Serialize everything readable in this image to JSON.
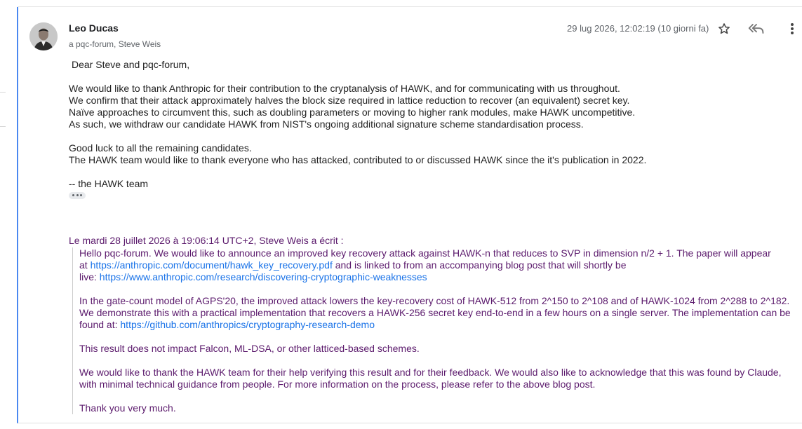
{
  "message": {
    "sender": "Leo Ducas",
    "recipients": "a pqc-forum, Steve Weis",
    "date": "29 lug 2026, 12:02:19 (10 giorni fa)",
    "icons": {
      "star": "star-icon",
      "reply_all": "reply-all-icon",
      "more": "more-vert-icon"
    },
    "greeting": "Dear Steve and pqc-forum,",
    "paragraph1": [
      "We would like to thank Anthropic for their contribution to the cryptanalysis of HAWK, and for communicating with us throughout.",
      "We confirm that their attack approximately halves the block size required in lattice reduction to recover (an equivalent) secret key.",
      "Naïve approaches to circumvent this, such as doubling parameters or moving to higher rank modules, make HAWK uncompetitive.",
      "As such, we withdraw our candidate HAWK from NIST's ongoing additional signature scheme standardisation process."
    ],
    "paragraph2": [
      "Good luck to all the remaining candidates.",
      "The HAWK team would like to thank everyone who has attacked, contributed to or discussed HAWK since the it's publication in 2022."
    ],
    "signoff": "-- the HAWK team"
  },
  "quoted": {
    "header": "Le mardi 28 juillet 2026 à 19:06:14 UTC+2, Steve Weis a écrit :",
    "p1_line1": "Hello pqc-forum. We would like to announce an improved key recovery attack against HAWK-n that reduces to SVP in dimension n/2 + 1. The paper will appear",
    "p1_line2_pre": "at ",
    "p1_link1": "https://anthropic.com/document/hawk_key_recovery.pdf",
    "p1_line2_post": " and is linked to from an accompanying blog post that will shortly be",
    "p1_line3_pre": "live: ",
    "p1_link2": "https://www.anthropic.com/research/discovering-cryptographic-weaknesses",
    "p2_line1": "In the gate-count model of AGPS'20, the improved attack lowers the key-recovery cost of HAWK-512 from 2^150 to 2^108 and of HAWK-1024 from 2^288 to 2^182.",
    "p2_line2": "We demonstrate this with a practical implementation that recovers a HAWK-256 secret key end-to-end in a few hours on a single server. The implementation can be",
    "p2_line3_pre": "found at: ",
    "p2_link": "https://github.com/anthropics/cryptography-research-demo",
    "p3": "This result does not impact Falcon, ML-DSA, or other latticed-based schemes.",
    "p4_line1": "We would like to thank the HAWK team for their help verifying this result and for their feedback. We would also like to acknowledge that this was found by Claude,",
    "p4_line2": "with minimal technical guidance from people. For more information on the process, please refer to the above blog post.",
    "p5": "Thank you very much."
  },
  "colors": {
    "accent": "#4a88f0",
    "quote_text": "#5b1a6c",
    "link": "#1a73e8"
  }
}
